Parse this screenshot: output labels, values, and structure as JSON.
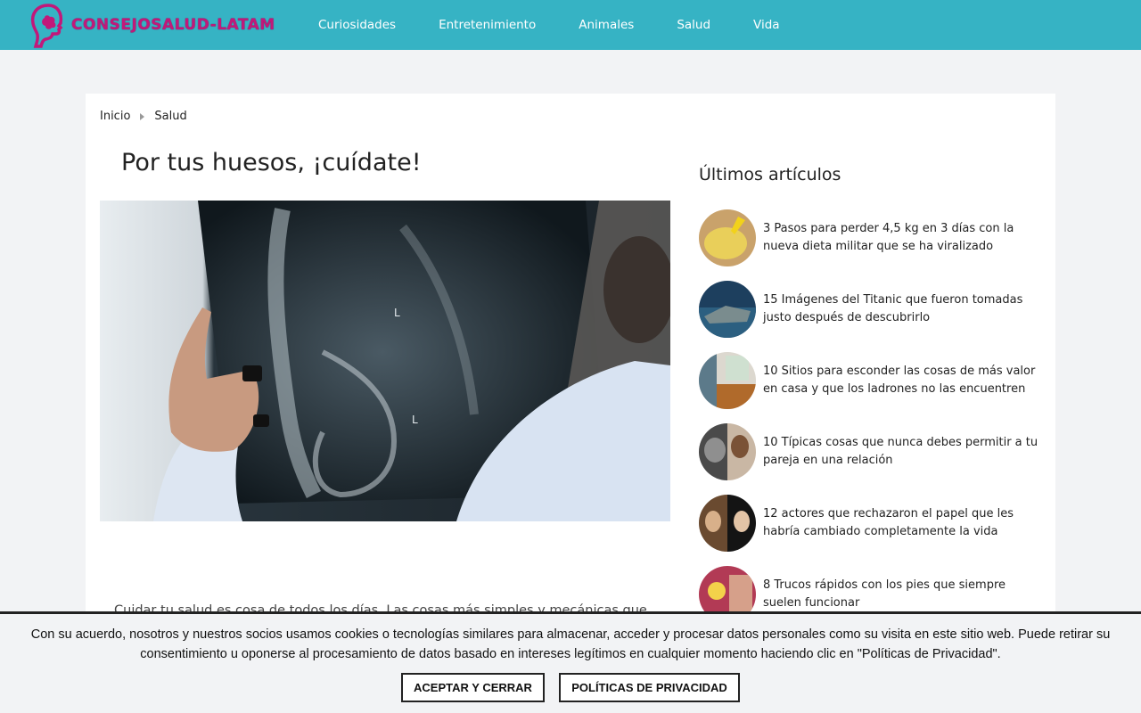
{
  "site": {
    "logo_text": "CONSEJOSALUD-LATAM"
  },
  "nav": [
    {
      "label": "Curiosidades"
    },
    {
      "label": "Entretenimiento"
    },
    {
      "label": "Animales"
    },
    {
      "label": "Salud"
    },
    {
      "label": "Vida"
    }
  ],
  "breadcrumb": {
    "home": "Inicio",
    "current": "Salud"
  },
  "article": {
    "title": "Por tus huesos, ¡cuídate!",
    "intro": "Cuidar tu salud es cosa de todos los días. Las cosas más simples y mecánicas que"
  },
  "sidebar": {
    "title": "Últimos artículos",
    "posts": [
      {
        "title": "3 Pasos para perder 4,5 kg en 3 días con la nueva dieta militar que se ha viralizado"
      },
      {
        "title": "15 Imágenes del Titanic que fueron tomadas justo después de descubrirlo"
      },
      {
        "title": "10 Sitios para esconder las cosas de más valor en casa y que los ladrones no las encuentren"
      },
      {
        "title": "10 Típicas cosas que nunca debes permitir a tu pareja en una relación"
      },
      {
        "title": "12 actores que rechazaron el papel que les habría cambiado completamente la vida"
      },
      {
        "title": "8 Trucos rápidos con los pies que siempre suelen funcionar"
      }
    ]
  },
  "cookie": {
    "text": "Con su acuerdo, nosotros y nuestros socios usamos cookies o tecnologías similares para almacenar, acceder y procesar datos personales como su visita en este sitio web. Puede retirar su consentimiento u oponerse al procesamiento de datos basado en intereses legítimos en cualquier momento haciendo clic en \"Políticas de Privacidad\".",
    "accept_label": "ACEPTAR Y CERRAR",
    "policy_label": "POLÍTICAS DE PRIVACIDAD"
  },
  "colors": {
    "topbar": "#36b3c4",
    "logo": "#c2187a"
  }
}
